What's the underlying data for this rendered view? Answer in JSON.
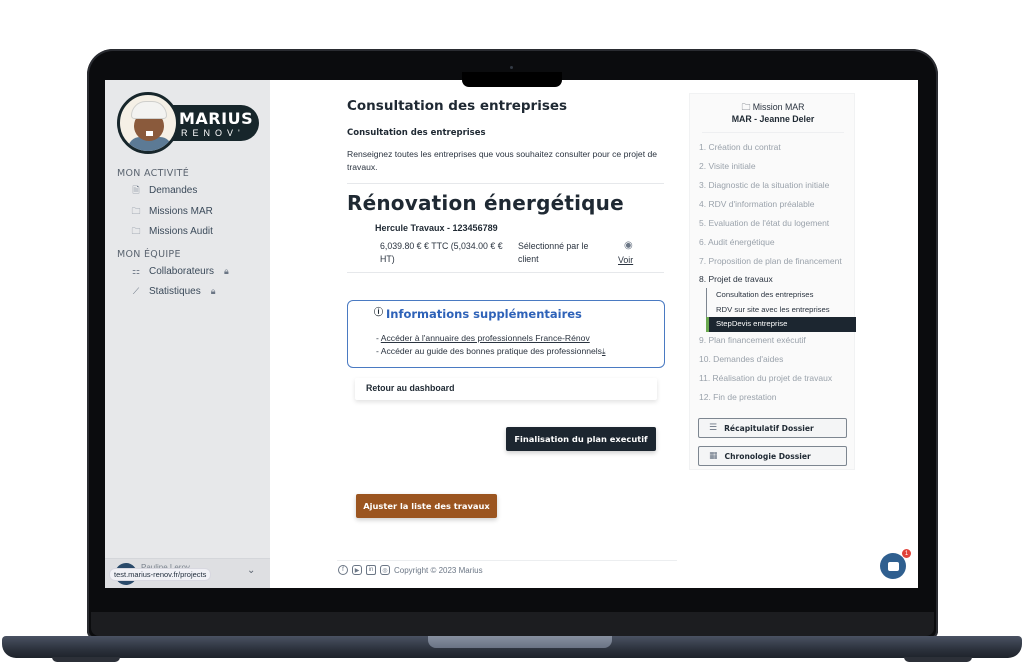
{
  "app": {
    "brand_name": "MARIUS",
    "brand_sub": "RENOV'"
  },
  "sidebar": {
    "sections": [
      {
        "title": "MON ACTIVITÉ",
        "items": [
          {
            "label": "Demandes",
            "icon": "document-icon",
            "locked": false
          },
          {
            "label": "Missions MAR",
            "icon": "folder-icon",
            "locked": false
          },
          {
            "label": "Missions Audit",
            "icon": "folder-icon",
            "locked": false
          }
        ]
      },
      {
        "title": "MON ÉQUIPE",
        "items": [
          {
            "label": "Collaborateurs",
            "icon": "team-icon",
            "locked": true
          },
          {
            "label": "Statistiques",
            "icon": "chart-icon",
            "locked": true
          }
        ]
      }
    ],
    "user_name": "Pauline Leroy",
    "url_tooltip": "test.marius-renov.fr/projects"
  },
  "main": {
    "title": "Consultation des entreprises",
    "subtitle": "Consultation des entreprises",
    "description": "Renseignez toutes les entreprises que vous souhaitez consulter pour ce projet de travaux.",
    "section_title": "Rénovation énergétique",
    "quote": {
      "company": "Hercule Travaux - 123456789",
      "price": "6,039.80 € € TTC (5,034.00 € € HT)",
      "status": "Sélectionné par le client",
      "view_label": "Voir"
    },
    "info": {
      "title": "Informations supplémentaires",
      "lines": [
        {
          "prefix": "- ",
          "link": "Accéder à l'annuaire des professionnels France-Rénov"
        },
        {
          "prefix": "- ",
          "text": "Accéder au guide des bonnes pratique des professionnels"
        }
      ]
    },
    "back_label": "Retour au dashboard",
    "finalize_label": "Finalisation du plan executif",
    "adjust_label": "Ajuster la liste des travaux",
    "footer": {
      "copyright": "Copyright © 2023 Marius",
      "socials": [
        "facebook-icon",
        "youtube-icon",
        "linkedin-icon",
        "instagram-icon"
      ]
    }
  },
  "panel": {
    "header": "Mission MAR",
    "subheader": "MAR - Jeanne Deler",
    "steps": [
      {
        "label": "1. Création du contrat",
        "active": false
      },
      {
        "label": "2. Visite initiale",
        "active": false
      },
      {
        "label": "3. Diagnostic de la situation initiale",
        "active": false
      },
      {
        "label": "4. RDV d'information préalable",
        "active": false
      },
      {
        "label": "5. Evaluation de l'état du logement",
        "active": false
      },
      {
        "label": "6. Audit énergétique",
        "active": false
      },
      {
        "label": "7. Proposition de plan de financement",
        "active": false
      },
      {
        "label": "8. Projet de travaux",
        "active": true
      },
      {
        "label": "9. Plan financement exécutif",
        "active": false
      },
      {
        "label": "10. Demandes d'aides",
        "active": false
      },
      {
        "label": "11. Réalisation du projet de travaux",
        "active": false
      },
      {
        "label": "12. Fin de prestation",
        "active": false
      }
    ],
    "substeps": [
      {
        "label": "Consultation des entreprises",
        "current": false
      },
      {
        "label": "RDV sur site avec les entreprises",
        "current": false
      },
      {
        "label": "StepDevis entreprise",
        "current": true
      }
    ],
    "summary_label": "Récapitulatif Dossier",
    "timeline_label": "Chronologie Dossier"
  },
  "chat": {
    "badge_count": "1"
  },
  "colors": {
    "brand_dark": "#1c2630",
    "accent_brown": "#9b5520",
    "info_blue": "#2e62b8",
    "active_step_marker": "#6aa84f"
  }
}
